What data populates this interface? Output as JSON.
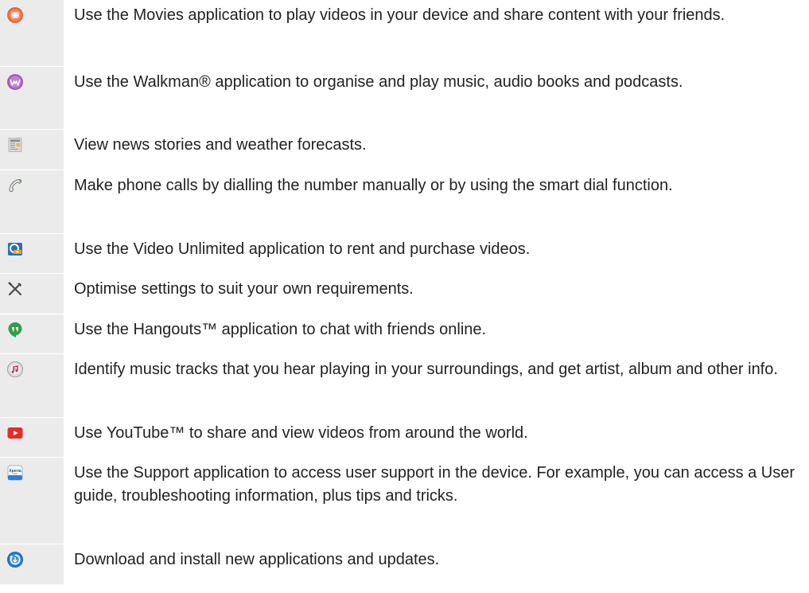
{
  "apps": [
    {
      "icon": "movies-icon",
      "text": "Use the Movies application to play videos in your device and share content with your friends."
    },
    {
      "icon": "walkman-icon",
      "text": "Use the Walkman® application to organise and play music, audio books and podcasts."
    },
    {
      "icon": "news-weather-icon",
      "text": "View news stories and weather forecasts."
    },
    {
      "icon": "phone-icon",
      "text": "Make phone calls by dialling the number manually or by using the smart dial function."
    },
    {
      "icon": "video-unlimited-icon",
      "text": "Use the Video Unlimited application to rent and purchase videos."
    },
    {
      "icon": "settings-icon",
      "text": "Optimise settings to suit your own requirements."
    },
    {
      "icon": "hangouts-icon",
      "text": "Use the Hangouts™ application to chat with friends online."
    },
    {
      "icon": "trackid-icon",
      "text": "Identify music tracks that you hear playing in your surroundings, and get artist, album and other info."
    },
    {
      "icon": "youtube-icon",
      "text": "Use YouTube™ to share and view videos from around the world."
    },
    {
      "icon": "support-icon",
      "icon_text": "Xperia",
      "icon_subtext": "care",
      "text": "Use the Support application to access user support in the device. For example, you can access a User guide, troubleshooting information, plus tips and tricks."
    },
    {
      "icon": "update-center-icon",
      "text": "Download and install new applications and updates."
    }
  ]
}
